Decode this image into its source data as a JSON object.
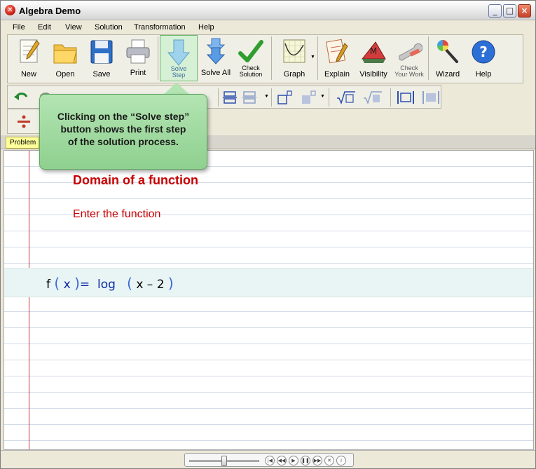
{
  "window": {
    "title": "Algebra Demo"
  },
  "menu": [
    "File",
    "Edit",
    "View",
    "Solution",
    "Transformation",
    "Help"
  ],
  "toolbar": {
    "new_label": "New",
    "open_label": "Open",
    "save_label": "Save",
    "print_label": "Print",
    "solve_step_line1": "Solve",
    "solve_step_line2": "Step",
    "solve_all_label": "Solve All",
    "check_solution_line1": "Check",
    "check_solution_line2": "Solution",
    "graph_label": "Graph",
    "explain_label": "Explain",
    "visibility_label": "Visibility",
    "check_work_line1": "Check",
    "check_work_line2": "Your Work",
    "wizard_label": "Wizard",
    "help_label": "Help"
  },
  "tab": {
    "problem_label": "Problem"
  },
  "document": {
    "heading": "Domain of a function",
    "instruction": "Enter the function",
    "formula": {
      "fn": "f",
      "var": "x",
      "equals": "=",
      "log": "log",
      "arg": "x – 2"
    }
  },
  "callout": {
    "line1": "Clicking on the “Solve step”",
    "line2": "button shows the first step",
    "line3": "of the solution process."
  },
  "player": {
    "progress": 0.5
  },
  "colors": {
    "accent_green": "#8fd08f",
    "heading_red": "#c80000",
    "formula_blue": "#0b2aa4"
  }
}
